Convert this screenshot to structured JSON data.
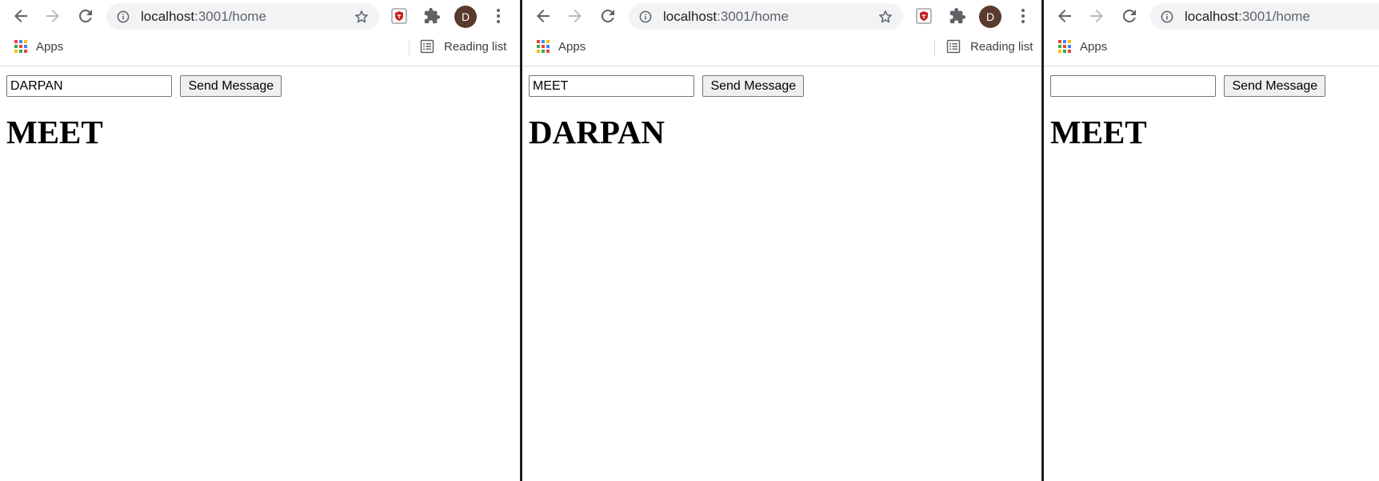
{
  "windows": [
    {
      "url_host": "localhost",
      "url_path": ":3001/home",
      "apps_label": "Apps",
      "reading_list_label": "Reading list",
      "avatar_letter": "D",
      "input_value": "DARPAN",
      "send_label": "Send Message",
      "heading": "MEET"
    },
    {
      "url_host": "localhost",
      "url_path": ":3001/home",
      "apps_label": "Apps",
      "reading_list_label": "Reading list",
      "avatar_letter": "D",
      "input_value": "MEET",
      "send_label": "Send Message",
      "heading": "DARPAN"
    },
    {
      "url_host": "localhost",
      "url_path": ":3001/home",
      "apps_label": "Apps",
      "input_value": "",
      "send_label": "Send Message",
      "heading": "MEET"
    }
  ],
  "icons": {
    "back": "arrow-left",
    "forward": "arrow-right",
    "reload": "reload",
    "info": "info-circle",
    "bookmark": "star-outline",
    "extension_shield": "red-shield",
    "extensions": "puzzle-piece",
    "menu": "three-dots-vertical",
    "apps": "apps-grid",
    "reading_list": "list"
  },
  "colors": {
    "omnibox_bg": "#f1f3f4",
    "avatar_bg": "#5b3a2e",
    "forward_disabled": "#b8babd",
    "icon_gray": "#5f6368",
    "apps_grid": [
      "#ea4335",
      "#4285f4",
      "#fbbc04",
      "#34a853",
      "#ea4335",
      "#4285f4",
      "#fbbc04",
      "#34a853",
      "#ea4335"
    ]
  }
}
